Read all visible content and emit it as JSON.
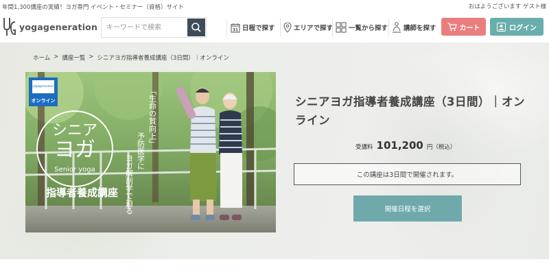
{
  "topbar": {
    "tagline": "年間1,300講座の実績！ヨガ専門 イベント・セミナー（資格）サイト",
    "greeting": "おはようございます ゲスト様"
  },
  "header": {
    "logo_text": "yogageneration",
    "search": {
      "placeholder": "キーワードで検索"
    },
    "nav": [
      {
        "label": "日程で探す",
        "icon": "calendar-icon",
        "calendar_day": "31"
      },
      {
        "label": "エリアで探す",
        "icon": "map-pin-icon"
      },
      {
        "label": "一覧から探す",
        "icon": "grid-icon"
      },
      {
        "label": "講師を探す",
        "icon": "instructor-icon"
      }
    ],
    "cart_label": "カート",
    "login_label": "ログイン"
  },
  "breadcrumb": [
    "ホーム",
    ">",
    "講座一覧",
    ">",
    "シニアヨガ指導者養成講座（3日間）｜オンライン"
  ],
  "course": {
    "title": "シニアヨガ指導者養成講座（3日間）｜オンライン",
    "price_label": "受講料",
    "price_value": "101,200",
    "price_unit": "円（税込）",
    "notice": "この講座は3日間で開催されます。",
    "select_button": "開催日程を選択",
    "image": {
      "badge_label": "オンライン",
      "badge_brand": "yogageneration",
      "title_line1": "シニア",
      "title_line2": "ヨガ",
      "subtitle": "Senior yoga",
      "course_name": "指導者養成講座",
      "vertical_text_1": "「生命の質向上」",
      "vertical_text_2": "予防医学に",
      "vertical_text_3": "ヨガ解剖学で迫る"
    }
  },
  "colors": {
    "cart": "#ea7e7e",
    "login": "#69aeac",
    "select_button": "#6fa9ac",
    "search_button": "#3e4c5a",
    "online_badge": "#1c6cc0"
  }
}
